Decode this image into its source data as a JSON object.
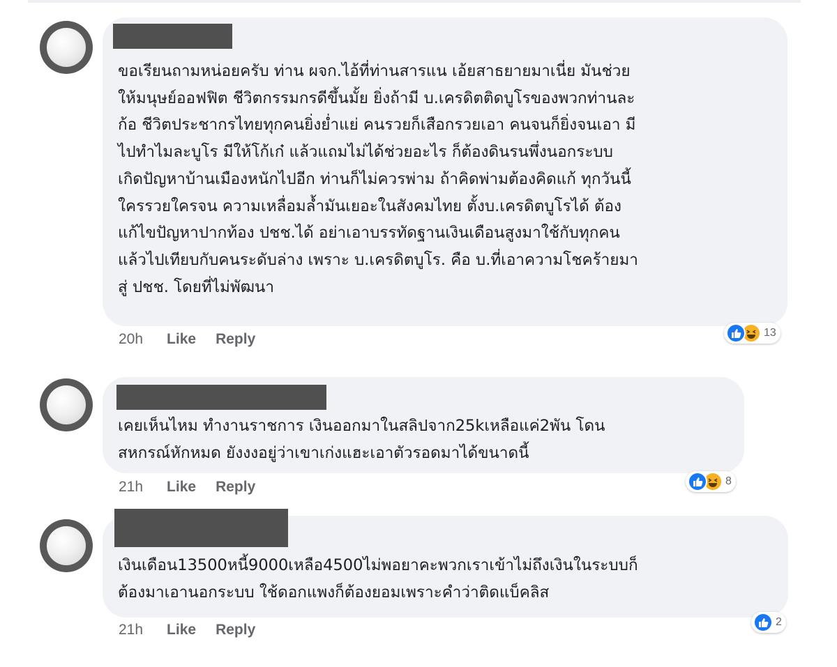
{
  "comments": [
    {
      "text": "ขอเรียนถามหน่อยครับ ท่าน ผจก.ไอ้ที่ท่านสารแน เอ้ยสาธยายมาเนี่ย มันช่วย\nให้มนุษย์ออฟฟิต ชีวิตกรรมกรดีขึ้นมั้ย ยิ่งถ้ามี บ.เครดิตติดบูโรของพวกท่านละ\nก้อ ชีวิตประชากรไทยทุกคนยิ่งย่ำแย่ คนรวยก็เสือกรวยเอา คนจนก็ยิ่งจนเอา มี\nไปทำไมละบูโร มีให้โก้เก๋ แล้วแถมไม่ได้ช่วยอะไร ก็ต้องดินรนพึ่งนอกระบบ\nเกิดปัญหาบ้านเมืองหนักไปอีก ท่านก็ไม่ควรพ่าม ถ้าคิดพ่ามต้องคิดแก้ ทุกวันนี้\nใครรวยใครจน ความเหลื่อมล้ำมันเยอะในสังคมไทย ตั้งบ.เครดิตบูโรได้ ต้อง\nแก้ไขปัญหาปากท้อง ปชช.ได้ อย่าเอาบรรทัดฐานเงินเดือนสูงมาใช้กับทุกคน\nแล้วไปเทียบกับคนระดับล่าง เพราะ บ.เครดิตบูโร. คือ บ.ที่เอาความโชคร้ายมา\nสู่ ปชช. โดยที่ไม่พัฒนา",
      "time": "20h",
      "like": "Like",
      "reply": "Reply",
      "reaction_count": "13",
      "reaction_icons": [
        "like-icon",
        "haha-icon"
      ]
    },
    {
      "text": "เคยเห็นไหม ทำงานราชการ เงินออกมาในสลิปจาก25kเหลือแค่2พัน โดน\nสหกรณ์หักหมด ยังงงอยู่ว่าเขาเก่งแฮะเอาตัวรอดมาได้ขนาดนี้",
      "time": "21h",
      "like": "Like",
      "reply": "Reply",
      "reaction_count": "8",
      "reaction_icons": [
        "like-icon",
        "haha-icon"
      ]
    },
    {
      "text": "เงินเดือน13500หนี้9000เหลือ4500ไม่พอยาคะพวกเราเข้าไม่ถึงเงินในระบบก็\nต้องมาเอานอกระบบ ใช้ดอกแพงก็ต้องยอมเพราะคำว่าติดแบ็คลิส",
      "time": "21h",
      "like": "Like",
      "reply": "Reply",
      "reaction_count": "2",
      "reaction_icons": [
        "like-icon"
      ]
    }
  ],
  "colors": {
    "bubble": "#f0f2f5",
    "text": "#1c1e21",
    "meta": "#65676b",
    "like_reaction": "#1877f2",
    "haha_reaction": "#f7b125"
  }
}
